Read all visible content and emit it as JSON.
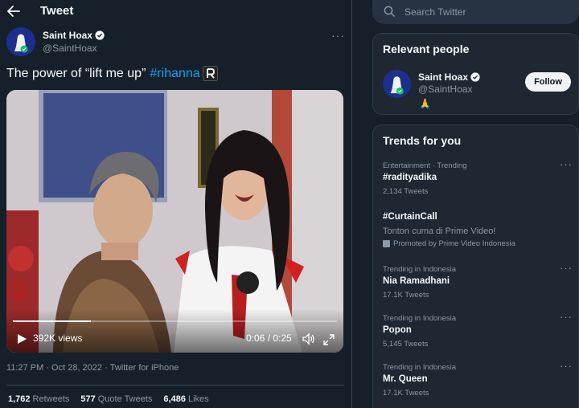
{
  "header": {
    "title": "Tweet"
  },
  "tweet": {
    "author_name": "Saint Hoax",
    "author_handle": "@SaintHoax",
    "text_prefix": "The power of “lift me up”",
    "hashtag": "#rihanna",
    "video": {
      "views": "392K views",
      "timecode": "0:06 / 0:25",
      "progress": 0.24
    },
    "time": "11:27 PM · Oct 28, 2022 ·",
    "source": "Twitter for iPhone",
    "stats": {
      "retweets_count": "1,762",
      "retweets_label": "Retweets",
      "quotes_count": "577",
      "quotes_label": "Quote Tweets",
      "likes_count": "6,486",
      "likes_label": "Likes"
    }
  },
  "search": {
    "placeholder": "Search Twitter"
  },
  "relevant": {
    "title": "Relevant people",
    "name": "Saint Hoax",
    "handle": "@SaintHoax",
    "bio": "🙏",
    "follow_label": "Follow"
  },
  "trends": {
    "title": "Trends for you",
    "items": [
      {
        "context": "Entertainment · Trending",
        "name": "#radityadika",
        "count": "2,134 Tweets"
      },
      {
        "context": "",
        "name": "#CurtainCall",
        "description": "Tonton cuma di Prime Video!",
        "promoted": "Promoted by Prime Video Indonesia"
      },
      {
        "context": "Trending in Indonesia",
        "name": "Nia Ramadhani",
        "count": "17.1K Tweets"
      },
      {
        "context": "Trending in Indonesia",
        "name": "Popon",
        "count": "5,145 Tweets"
      },
      {
        "context": "Trending in Indonesia",
        "name": "Mr. Queen",
        "count": "17.1K Tweets"
      }
    ]
  },
  "colors": {
    "background": "#15202b",
    "accent": "#1d9bf0",
    "muted": "#8b98a5",
    "panel": "#1e2732"
  }
}
